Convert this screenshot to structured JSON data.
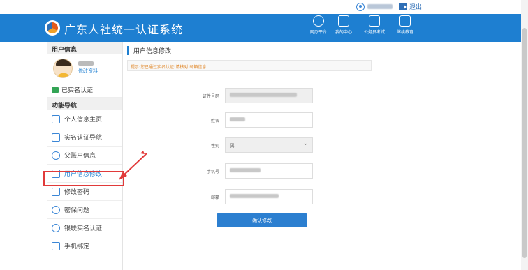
{
  "topbar": {
    "user_masked": "",
    "logout_label": "退出"
  },
  "header": {
    "site_title": "广东人社统一认证系统",
    "nav": [
      {
        "label": "网办平台",
        "icon": "compass-icon"
      },
      {
        "label": "我的中心",
        "icon": "id-card-icon"
      },
      {
        "label": "公务员考试",
        "icon": "exam-icon"
      },
      {
        "label": "继续教育",
        "icon": "monitor-icon"
      }
    ]
  },
  "sidebar": {
    "user_info_title": "用户信息",
    "edit_profile": "修改资料",
    "verified_label": "已实名认证",
    "nav_title": "功能导航",
    "items": [
      {
        "label": "个人信息主页",
        "icon": "people-icon"
      },
      {
        "label": "实名认证导航",
        "icon": "id-card-icon"
      },
      {
        "label": "父账户信息",
        "icon": "user-icon"
      },
      {
        "label": "用户信息修改",
        "icon": "edit-icon"
      },
      {
        "label": "修改密码",
        "icon": "lock-icon"
      },
      {
        "label": "密保问题",
        "icon": "shield-icon"
      },
      {
        "label": "银联实名认证",
        "icon": "user-icon"
      },
      {
        "label": "手机绑定",
        "icon": "phone-icon"
      }
    ]
  },
  "content": {
    "breadcrumb": "用户信息修改",
    "tip": "提示:您已通过实名认证!请核对 邮箱信息",
    "form": {
      "id_label": "证件号码",
      "name_label": "姓名",
      "gender_label": "性别",
      "gender_value": "男",
      "phone_label": "手机号",
      "email_label": "邮箱"
    },
    "submit_label": "确认修改"
  }
}
